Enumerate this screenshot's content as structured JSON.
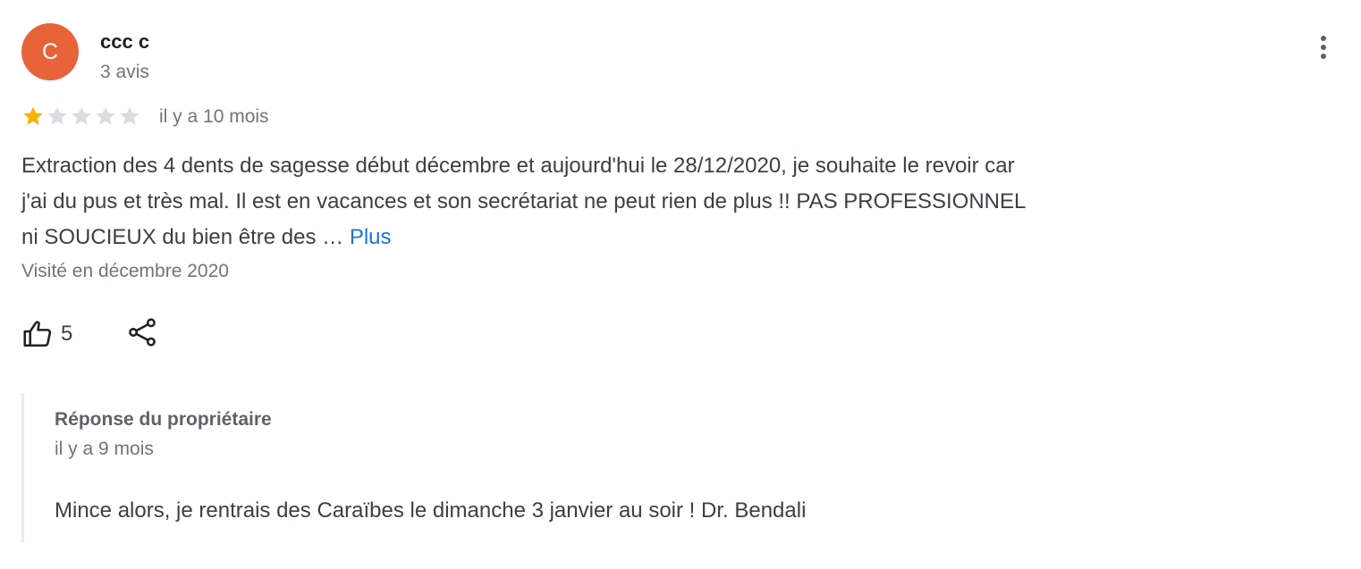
{
  "review": {
    "author": {
      "initial": "C",
      "name": "ccc c",
      "meta": "3 avis",
      "avatar_color": "#e8633a"
    },
    "menu_icon": "more-vert-icon",
    "rating": {
      "value": 1,
      "max": 5,
      "filled_color": "#f4b400",
      "empty_color": "#dadce0"
    },
    "date": "il y a 10 mois",
    "text_line1": "Extraction des 4 dents de sagesse début décembre et aujourd'hui le 28/12/2020, je souhaite le revoir car",
    "text_line2": "j'ai du pus et très mal. Il est en vacances et son secrétariat ne peut rien de plus !! PAS PROFESSIONNEL",
    "text_line3": "ni SOUCIEUX du bien être des …",
    "more_label": "Plus",
    "visited": "Visité en décembre 2020",
    "likes": "5",
    "like_icon": "thumb-up-icon",
    "share_icon": "share-icon"
  },
  "owner_reply": {
    "title": "Réponse du propriétaire",
    "date": "il y a 9 mois",
    "text": "Mince alors, je rentrais des Caraïbes le dimanche 3 janvier au soir ! Dr. Bendali"
  },
  "colors": {
    "link": "#1a73e8",
    "text_primary": "#202124",
    "text_secondary": "#70757a"
  }
}
